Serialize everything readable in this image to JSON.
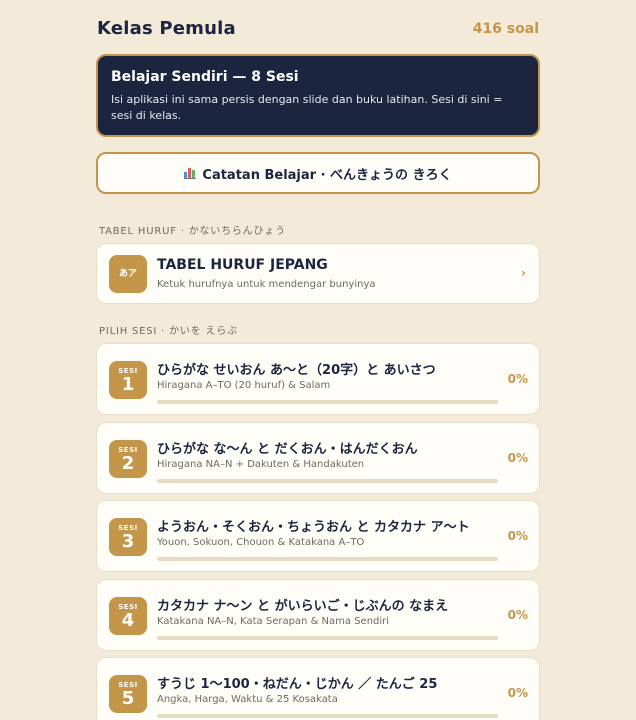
{
  "header": {
    "title": "Kelas Pemula",
    "count": "416 soal"
  },
  "hero": {
    "title": "Belajar Sendiri — 8 Sesi",
    "description": "Isi aplikasi ini sama persis dengan slide dan buku latihan. Sesi di sini = sesi di kelas."
  },
  "log_button": {
    "label": "Catatan Belajar · べんきょうの きろく",
    "icon": "bar-chart-icon"
  },
  "kana_section": {
    "label": "TABEL HURUF · かないちらんひょう",
    "card": {
      "badge": "あア",
      "title": "TABEL HURUF JEPANG",
      "subtitle": "Ketuk hurufnya untuk mendengar bunyinya",
      "chevron": "›"
    }
  },
  "session_section": {
    "label": "PILIH SESI · かいを えらぶ"
  },
  "session_badge_label": "SESI",
  "sessions": [
    {
      "number": "1",
      "title": "ひらがな せいおん あ〜と（20字）と あいさつ",
      "subtitle": "Hiragana A–TO (20 huruf) & Salam",
      "percent": "0%",
      "progress": 0
    },
    {
      "number": "2",
      "title": "ひらがな な〜ん と だくおん・はんだくおん",
      "subtitle": "Hiragana NA–N + Dakuten & Handakuten",
      "percent": "0%",
      "progress": 0
    },
    {
      "number": "3",
      "title": "ようおん・そくおん・ちょうおん と カタカナ ア〜ト",
      "subtitle": "Youon, Sokuon, Chouon & Katakana A–TO",
      "percent": "0%",
      "progress": 0
    },
    {
      "number": "4",
      "title": "カタカナ ナ〜ン と がいらいご・じぶんの なまえ",
      "subtitle": "Katakana NA–N, Kata Serapan & Nama Sendiri",
      "percent": "0%",
      "progress": 0
    },
    {
      "number": "5",
      "title": "すうじ 1〜100・ねだん・じかん ／ たんご 25",
      "subtitle": "Angka, Harga, Waktu & 25 Kosakata",
      "percent": "0%",
      "progress": 0
    }
  ],
  "colors": {
    "background": "#f3ead9",
    "navy": "#1b2540",
    "gold": "#c4964a"
  }
}
